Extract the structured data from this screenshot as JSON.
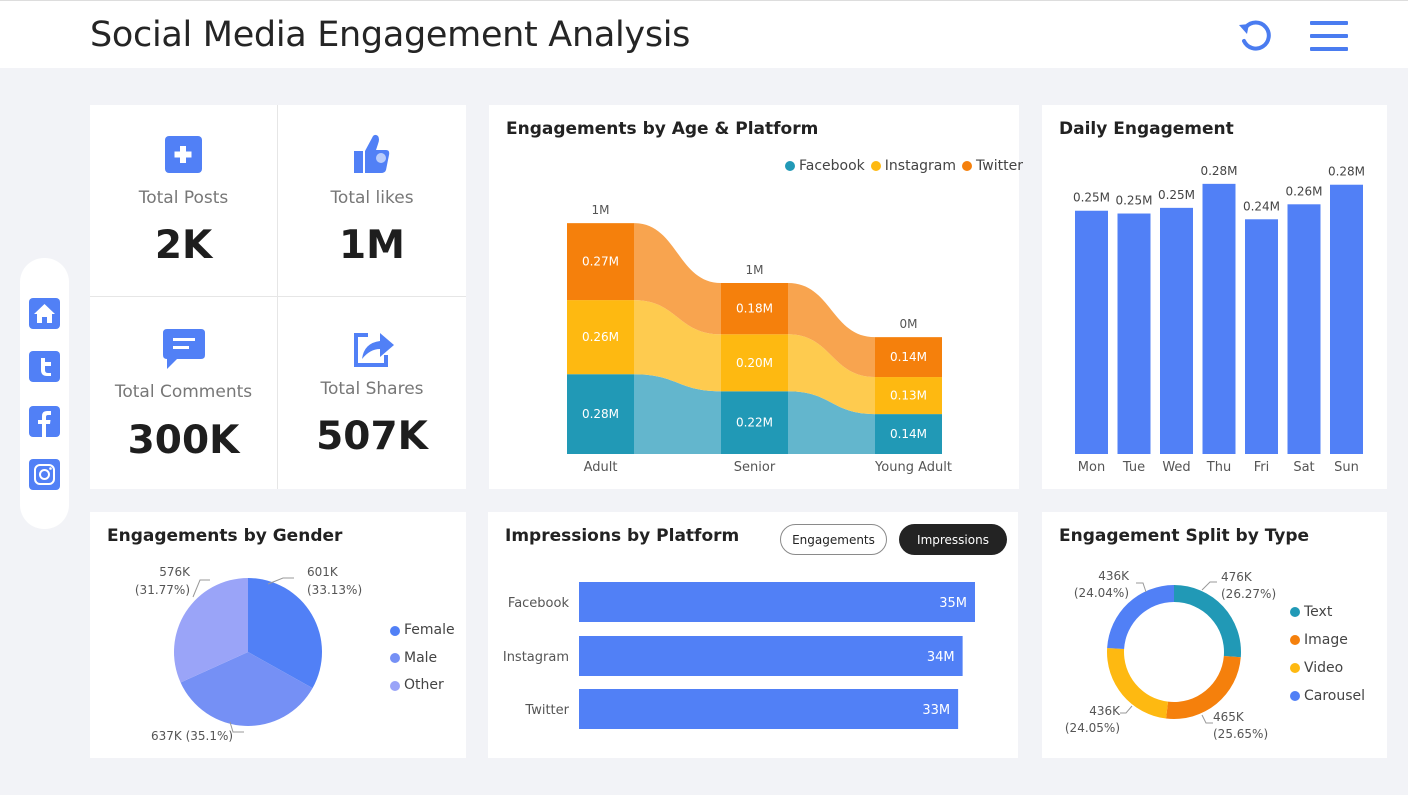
{
  "header": {
    "title": "Social Media Engagement Analysis",
    "refresh_icon": "refresh-icon",
    "menu_icon": "hamburger-menu-icon"
  },
  "sidebar": {
    "items": [
      {
        "name": "home",
        "icon": "home-icon"
      },
      {
        "name": "twitter",
        "icon": "twitter-icon"
      },
      {
        "name": "facebook",
        "icon": "facebook-icon"
      },
      {
        "name": "instagram",
        "icon": "instagram-icon"
      }
    ]
  },
  "kpis": [
    {
      "label": "Total Posts",
      "value": "2K",
      "icon": "plus-icon"
    },
    {
      "label": "Total likes",
      "value": "1M",
      "icon": "thumbs-up-icon"
    },
    {
      "label": "Total Comments",
      "value": "300K",
      "icon": "comment-icon"
    },
    {
      "label": "Total Shares",
      "value": "507K",
      "icon": "share-icon"
    }
  ],
  "colors": {
    "accent": "#5180f6",
    "facebook": "#2199b6",
    "instagram": "#feb911",
    "twitter": "#f5800c",
    "female": "#5180f6",
    "male": "#7590f5",
    "other": "#9aa4f8"
  },
  "age_platform": {
    "title": "Engagements by Age & Platform",
    "legend": [
      "Facebook",
      "Instagram",
      "Twitter"
    ],
    "chart_data": {
      "type": "bar",
      "stacked": true,
      "categories": [
        "Adult",
        "Senior",
        "Young Adult"
      ],
      "totals": [
        "1M",
        "1M",
        "0M"
      ],
      "series": [
        {
          "name": "Facebook",
          "values": [
            0.28,
            0.22,
            0.14
          ],
          "labels": [
            "0.28M",
            "0.22M",
            "0.14M"
          ]
        },
        {
          "name": "Instagram",
          "values": [
            0.26,
            0.2,
            0.13
          ],
          "labels": [
            "0.26M",
            "0.20M",
            "0.13M"
          ]
        },
        {
          "name": "Twitter",
          "values": [
            0.27,
            0.18,
            0.14
          ],
          "labels": [
            "0.27M",
            "0.18M",
            "0.14M"
          ]
        }
      ]
    }
  },
  "daily": {
    "title": "Daily Engagement",
    "chart_data": {
      "type": "bar",
      "categories": [
        "Mon",
        "Tue",
        "Wed",
        "Thu",
        "Fri",
        "Sat",
        "Sun"
      ],
      "values": [
        0.2534,
        0.2505,
        0.2564,
        0.2814,
        0.2445,
        0.2601,
        0.2805
      ],
      "labels": [
        "0.25M",
        "0.25M",
        "0.25M",
        "0.28M",
        "0.24M",
        "0.26M",
        "0.28M"
      ]
    }
  },
  "gender": {
    "title": "Engagements by Gender",
    "legend": [
      "Female",
      "Male",
      "Other"
    ],
    "chart_data": {
      "type": "pie",
      "categories": [
        "Female",
        "Male",
        "Other"
      ],
      "values": [
        601,
        637,
        576
      ],
      "labels": [
        [
          "601K",
          "(33.13%)"
        ],
        [
          "637K (35.1%)"
        ],
        [
          "576K",
          "(31.77%)"
        ]
      ]
    }
  },
  "impressions": {
    "title": "Impressions by Platform",
    "toggle": {
      "engagements": "Engagements",
      "impressions": "Impressions"
    },
    "chart_data": {
      "type": "bar",
      "orientation": "horizontal",
      "categories": [
        "Facebook",
        "Instagram",
        "Twitter"
      ],
      "values": [
        35.2,
        34.1,
        33.7
      ],
      "labels": [
        "35M",
        "34M",
        "33M"
      ]
    }
  },
  "type_split": {
    "title": "Engagement Split by Type",
    "legend": [
      "Text",
      "Image",
      "Video",
      "Carousel"
    ],
    "chart_data": {
      "type": "pie",
      "donut": true,
      "categories": [
        "Text",
        "Image",
        "Video",
        "Carousel"
      ],
      "values": [
        476,
        465,
        436,
        436
      ],
      "labels": [
        [
          "476K",
          "(26.27%)"
        ],
        [
          "465K",
          "(25.65%)"
        ],
        [
          "436K",
          "(24.05%)"
        ],
        [
          "436K",
          "(24.04%)"
        ]
      ]
    }
  }
}
